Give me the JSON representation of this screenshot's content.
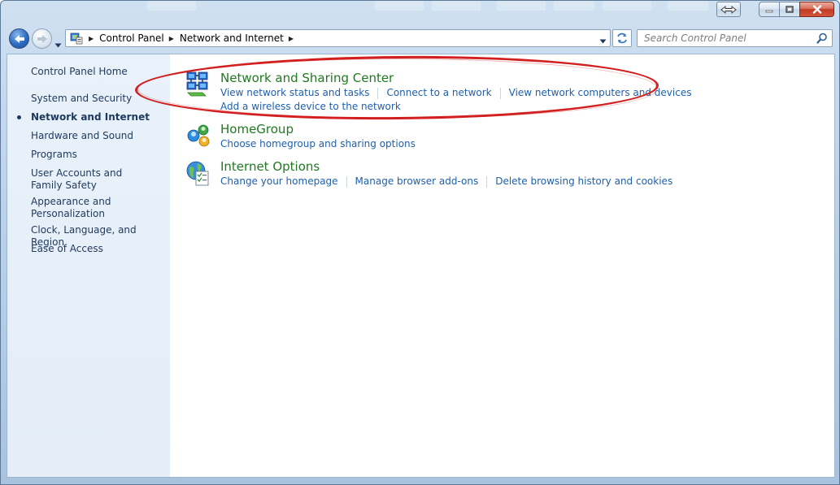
{
  "window": {
    "caption_buttons": [
      "minimize-icon",
      "maximize-icon",
      "close-icon"
    ]
  },
  "address": {
    "crumbs": [
      "Control Panel",
      "Network and Internet"
    ],
    "search_placeholder": "Search Control Panel"
  },
  "sidebar": {
    "items": [
      {
        "label": "Control Panel Home",
        "current": false
      },
      {
        "label": "System and Security",
        "current": false
      },
      {
        "label": "Network and Internet",
        "current": true
      },
      {
        "label": "Hardware and Sound",
        "current": false
      },
      {
        "label": "Programs",
        "current": false
      },
      {
        "label": "User Accounts and Family Safety",
        "current": false
      },
      {
        "label": "Appearance and Personalization",
        "current": false
      },
      {
        "label": "Clock, Language, and Region",
        "current": false
      },
      {
        "label": "Ease of Access",
        "current": false
      }
    ]
  },
  "categories": [
    {
      "title": "Network and Sharing Center",
      "icon": "network-sharing-icon",
      "links": [
        "View network status and tasks",
        "Connect to a network",
        "View network computers and devices"
      ],
      "links2": [
        "Add a wireless device to the network"
      ]
    },
    {
      "title": "HomeGroup",
      "icon": "homegroup-icon",
      "links": [
        "Choose homegroup and sharing options"
      ]
    },
    {
      "title": "Internet Options",
      "icon": "internet-options-icon",
      "links": [
        "Change your homepage",
        "Manage browser add-ons",
        "Delete browsing history and cookies"
      ]
    }
  ],
  "colors": {
    "link": "#1e5fae",
    "category_title": "#1f7a1f",
    "annotation": "#d21f1f"
  }
}
